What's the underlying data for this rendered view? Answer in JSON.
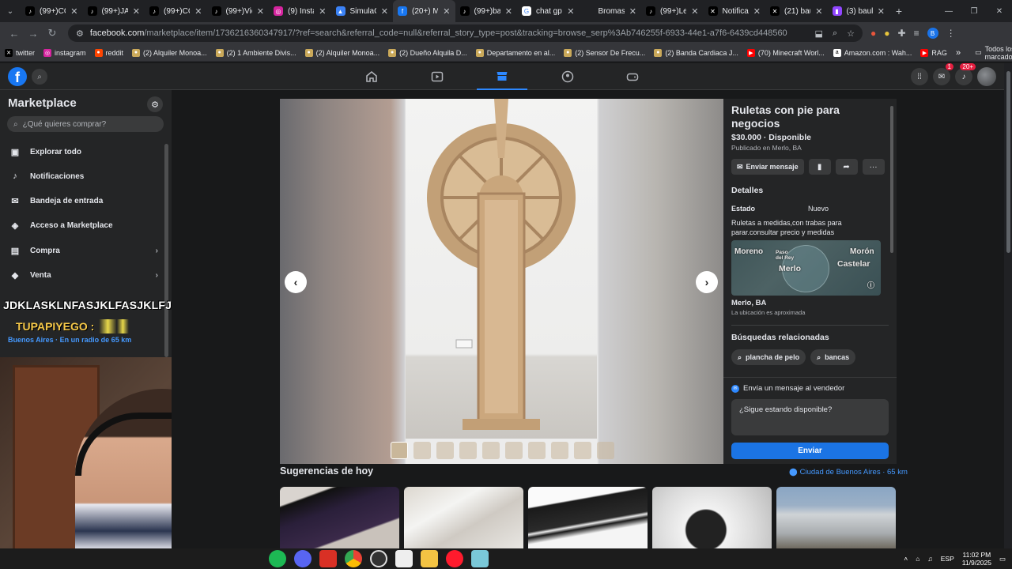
{
  "browser": {
    "tabs": [
      {
        "title": "(99+)CO",
        "icon": "tiktok-icon",
        "color": "#000000",
        "glyph": "♪"
      },
      {
        "title": "(99+)JAJ",
        "icon": "tiktok-icon",
        "color": "#000000",
        "glyph": "♪"
      },
      {
        "title": "(99+)CO",
        "icon": "tiktok-icon",
        "color": "#000000",
        "glyph": "♪"
      },
      {
        "title": "(99+)Vid",
        "icon": "tiktok-icon",
        "color": "#000000",
        "glyph": "♪"
      },
      {
        "title": "(9) Instag",
        "icon": "instagram-icon",
        "color": "#d6249f",
        "glyph": "◎"
      },
      {
        "title": "SimulaC",
        "icon": "simulation-icon",
        "color": "#3b82f6",
        "glyph": "▲"
      },
      {
        "title": "(20+) M",
        "icon": "facebook-icon",
        "color": "#1877f2",
        "glyph": "f",
        "active": true
      },
      {
        "title": "(99+)bar",
        "icon": "tiktok-icon",
        "color": "#000000",
        "glyph": "♪"
      },
      {
        "title": "chat gpt",
        "icon": "google-icon",
        "color": "#ffffff",
        "glyph": "G"
      },
      {
        "title": "Bromas",
        "icon": "page-icon",
        "color": "#202124",
        "glyph": ""
      },
      {
        "title": "(99+)Leg",
        "icon": "tiktok-icon",
        "color": "#000000",
        "glyph": "♪"
      },
      {
        "title": "Notificac",
        "icon": "x-icon",
        "color": "#000000",
        "glyph": "✕"
      },
      {
        "title": "(21) bau",
        "icon": "x-icon",
        "color": "#000000",
        "glyph": "✕"
      },
      {
        "title": "(3) baul",
        "icon": "twitch-icon",
        "color": "#9146ff",
        "glyph": "▮"
      }
    ],
    "url_domain": "facebook.com",
    "url_rest": "/marketplace/item/1736216360347917/?ref=search&referral_code=null&referral_story_type=post&tracking=browse_serp%3Ab746255f-6933-44e1-a7f6-6439cd448560",
    "profile_initial": "B",
    "bookmarks": [
      {
        "label": "twitter",
        "icon": "x-icon",
        "color": "#000000",
        "glyph": "✕"
      },
      {
        "label": "instagram",
        "icon": "instagram-icon",
        "color": "#d6249f",
        "glyph": "◎"
      },
      {
        "label": "reddit",
        "icon": "reddit-icon",
        "color": "#ff4500",
        "glyph": "●"
      },
      {
        "label": "(2) Alquiler Monoa...",
        "icon": "marketplace-icon",
        "color": "#caa95a",
        "glyph": "●"
      },
      {
        "label": "(2) 1 Ambiente Divis...",
        "icon": "marketplace-icon",
        "color": "#caa95a",
        "glyph": "●"
      },
      {
        "label": "(2) Alquiler Monoa...",
        "icon": "marketplace-icon",
        "color": "#caa95a",
        "glyph": "●"
      },
      {
        "label": "(2) Dueño Alquila D...",
        "icon": "marketplace-icon",
        "color": "#caa95a",
        "glyph": "●"
      },
      {
        "label": "Departamento en al...",
        "icon": "marketplace-icon",
        "color": "#caa95a",
        "glyph": "●"
      },
      {
        "label": "(2) Sensor De Frecu...",
        "icon": "marketplace-icon",
        "color": "#caa95a",
        "glyph": "●"
      },
      {
        "label": "(2) Banda Cardiaca J...",
        "icon": "marketplace-icon",
        "color": "#caa95a",
        "glyph": "●"
      },
      {
        "label": "(70) Minecraft Worl...",
        "icon": "youtube-icon",
        "color": "#ff0000",
        "glyph": "▶"
      },
      {
        "label": "Amazon.com : Wah...",
        "icon": "amazon-icon",
        "color": "#ffffff",
        "glyph": "a"
      },
      {
        "label": "RAG",
        "icon": "youtube-icon",
        "color": "#ff0000",
        "glyph": "▶"
      }
    ],
    "bookmarks_all": "Todos los marcadores"
  },
  "fb": {
    "messenger_badge": "1",
    "notif_badge": "20+"
  },
  "sidebar": {
    "title": "Marketplace",
    "search_placeholder": "¿Qué quieres comprar?",
    "items": [
      {
        "label": "Explorar todo",
        "icon": "storefront-icon",
        "glyph": "▣"
      },
      {
        "label": "Notificaciones",
        "icon": "bell-icon",
        "glyph": "♪"
      },
      {
        "label": "Bandeja de entrada",
        "icon": "inbox-icon",
        "glyph": "✉"
      },
      {
        "label": "Acceso a Marketplace",
        "icon": "shield-icon",
        "glyph": "◈"
      },
      {
        "label": "Compra",
        "icon": "shopping-bag-icon",
        "glyph": "▤",
        "chevron": true
      },
      {
        "label": "Venta",
        "icon": "tag-icon",
        "glyph": "◆",
        "chevron": true
      }
    ]
  },
  "overlay": {
    "chat_text": "JDKLASKLNFASJKLFASJKLFJKASL",
    "username": "TUPAPIYEGO :",
    "location": "Buenos Aires · En un radio de 65 km"
  },
  "listing": {
    "title": "Ruletas con pie para negocios",
    "price_status": "$30.000 · Disponible",
    "published": "Publicado en Merlo, BA",
    "message_button": "Enviar mensaje",
    "details_heading": "Detalles",
    "condition_label": "Estado",
    "condition_value": "Nuevo",
    "description": "Ruletas a medidas,con trabas para parar.consultar precio y medidas",
    "map_labels": {
      "moreno": "Moreno",
      "paso": "Paso del Rey",
      "merlo": "Merlo",
      "moron": "Morón",
      "castelar": "Castelar"
    },
    "location": "Merlo, BA",
    "location_note": "La ubicación es aproximada",
    "related_heading": "Búsquedas relacionadas",
    "related": [
      "plancha de pelo",
      "bancas"
    ]
  },
  "message": {
    "heading": "Envía un mensaje al vendedor",
    "text": "¿Sigue estando disponible?",
    "send": "Enviar"
  },
  "suggestions": {
    "title": "Sugerencias de hoy",
    "location": "Ciudad de Buenos Aires · 65 km"
  },
  "taskbar": {
    "lang": "ESP",
    "time": "11:02 PM",
    "date": "11/9/2025"
  }
}
